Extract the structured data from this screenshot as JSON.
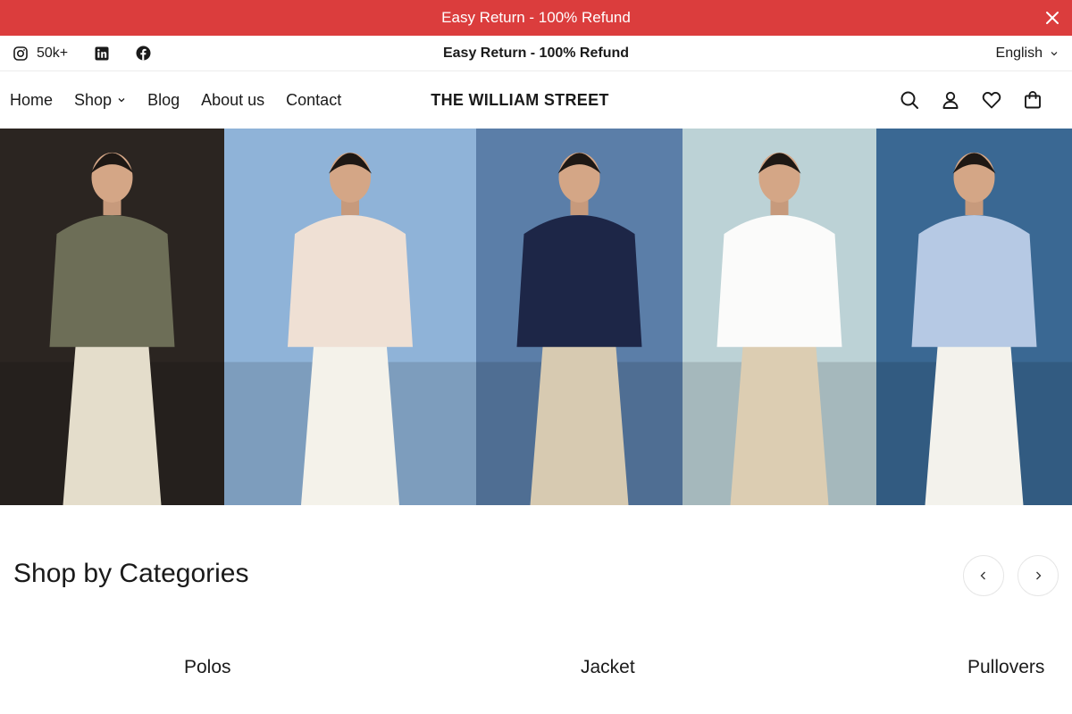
{
  "announcement": {
    "text": "Easy Return - 100% Refund",
    "close_icon": "close-icon",
    "color": "#db3d3d"
  },
  "topbar": {
    "social": [
      {
        "icon": "instagram-icon",
        "count": "50k+"
      },
      {
        "icon": "linkedin-icon"
      },
      {
        "icon": "facebook-icon"
      }
    ],
    "message": "Easy Return - 100% Refund",
    "language": "English"
  },
  "nav": {
    "links": [
      "Home",
      "Shop",
      "Blog",
      "About us",
      "Contact"
    ],
    "logo": "THE WILLIAM STREET",
    "icons": [
      "search-icon",
      "account-icon",
      "wishlist-icon",
      "cart-icon"
    ]
  },
  "hero": {
    "photos": [
      {
        "name": "man-olive-shirt",
        "background": "#2b2521",
        "shirt": "#6d6e57",
        "trousers": "#e4ddcb"
      },
      {
        "name": "man-pink-shirt",
        "background": "#8fb3d8",
        "shirt": "#efe0d4",
        "trousers": "#f4f2ea"
      },
      {
        "name": "man-navy-shirt",
        "background": "#5b7ea8",
        "shirt": "#1d2647",
        "trousers": "#d7cab1"
      },
      {
        "name": "man-white-shirt",
        "background": "#bcd2d6",
        "shirt": "#fbfbfa",
        "trousers": "#dccdb2"
      },
      {
        "name": "man-blue-shirt",
        "background": "#3a6893",
        "shirt": "#b6c9e4",
        "trousers": "#f3f2ec"
      }
    ]
  },
  "categories": {
    "title": "Shop by Categories",
    "items": [
      "Polos",
      "Jacket",
      "Pullovers"
    ],
    "prev_icon": "chevron-left-icon",
    "next_icon": "chevron-right-icon"
  }
}
